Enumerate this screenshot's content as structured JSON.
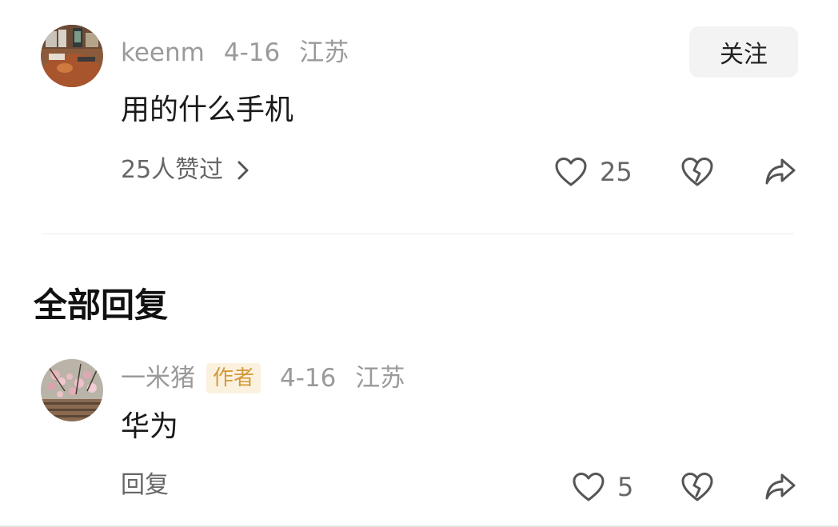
{
  "comment": {
    "username": "keenm",
    "date": "4-16",
    "location": "江苏",
    "follow_label": "关注",
    "text": "用的什么手机",
    "liked_by": "25人赞过",
    "like_count": "25"
  },
  "replies_section": {
    "title": "全部回复"
  },
  "reply": {
    "username": "一米猪",
    "badge": "作者",
    "date": "4-16",
    "location": "江苏",
    "text": "华为",
    "reply_label": "回复",
    "like_count": "5"
  },
  "colors": {
    "meta_text": "#9a9a9a",
    "author_badge_bg": "#fbf1df",
    "author_badge_text": "#d29a3a",
    "follow_bg": "#f3f3f3"
  },
  "icons": [
    "avatar",
    "chevron-right-icon",
    "heart-icon",
    "broken-heart-icon",
    "share-icon"
  ]
}
